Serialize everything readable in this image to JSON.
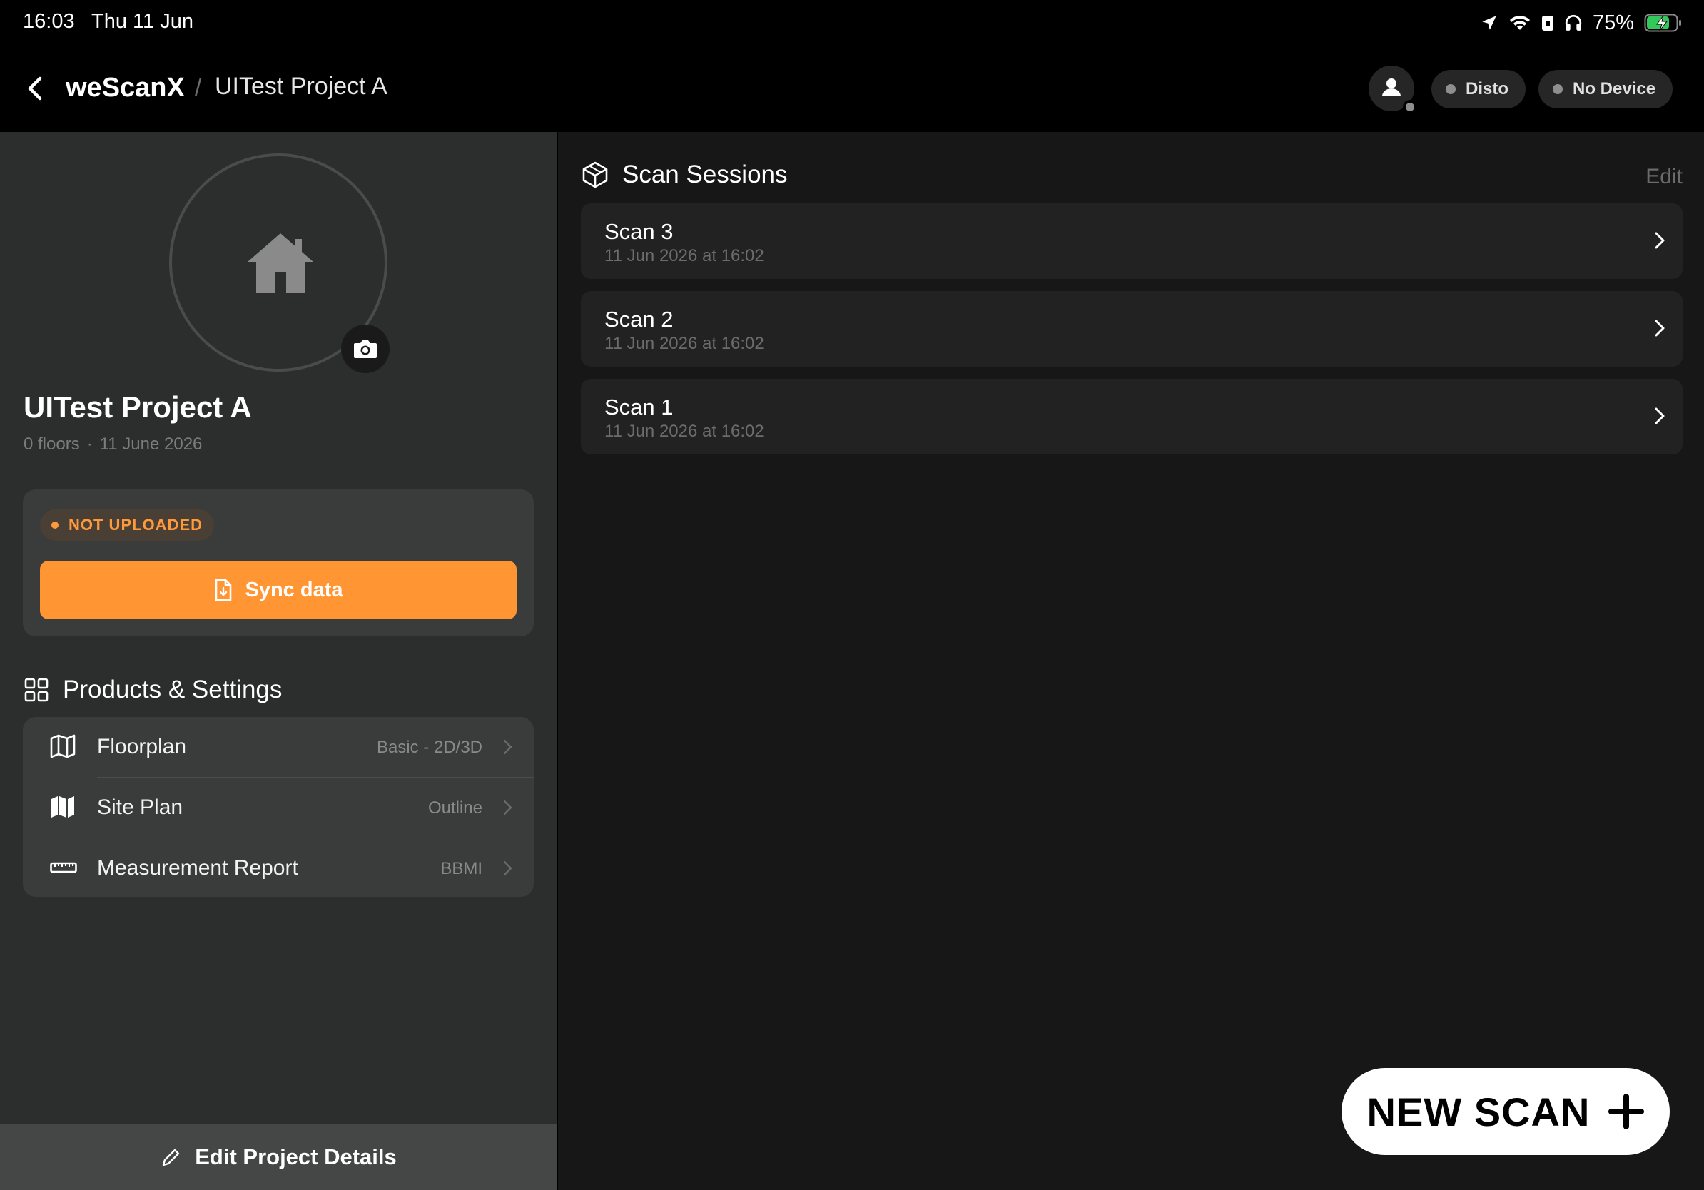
{
  "status_bar": {
    "time": "16:03",
    "date": "Thu 11 Jun",
    "battery_percent": "75%",
    "icons": [
      "location-arrow-icon",
      "wifi-icon",
      "lock-icon",
      "headphones-icon",
      "battery-charging-icon"
    ]
  },
  "nav": {
    "app_name": "weScanX",
    "separator": "/",
    "project_name": "UITest Project A",
    "pills": {
      "disto_label": "Disto",
      "device_label": "No Device"
    }
  },
  "project": {
    "title": "UITest Project A",
    "floors": "0 floors",
    "meta_sep": "·",
    "date": "11 June 2026",
    "upload_status": "NOT UPLOADED",
    "sync_label": "Sync data"
  },
  "products_settings": {
    "title": "Products & Settings",
    "items": [
      {
        "label": "Floorplan",
        "value": "Basic - 2D/3D",
        "icon": "map-outline-icon"
      },
      {
        "label": "Site Plan",
        "value": "Outline",
        "icon": "map-filled-icon"
      },
      {
        "label": "Measurement Report",
        "value": "BBMI",
        "icon": "ruler-icon"
      }
    ]
  },
  "edit_project_label": "Edit Project Details",
  "scan_sessions": {
    "title": "Scan Sessions",
    "edit_label": "Edit",
    "items": [
      {
        "name": "Scan 3",
        "date": "11 Jun 2026 at 16:02"
      },
      {
        "name": "Scan 2",
        "date": "11 Jun 2026 at 16:02"
      },
      {
        "name": "Scan 1",
        "date": "11 Jun 2026 at 16:02"
      }
    ]
  },
  "new_scan_label": "NEW SCAN",
  "colors": {
    "accent_orange": "#ff9533",
    "panel_left": "#2c2d2d",
    "panel_right": "#171717"
  }
}
